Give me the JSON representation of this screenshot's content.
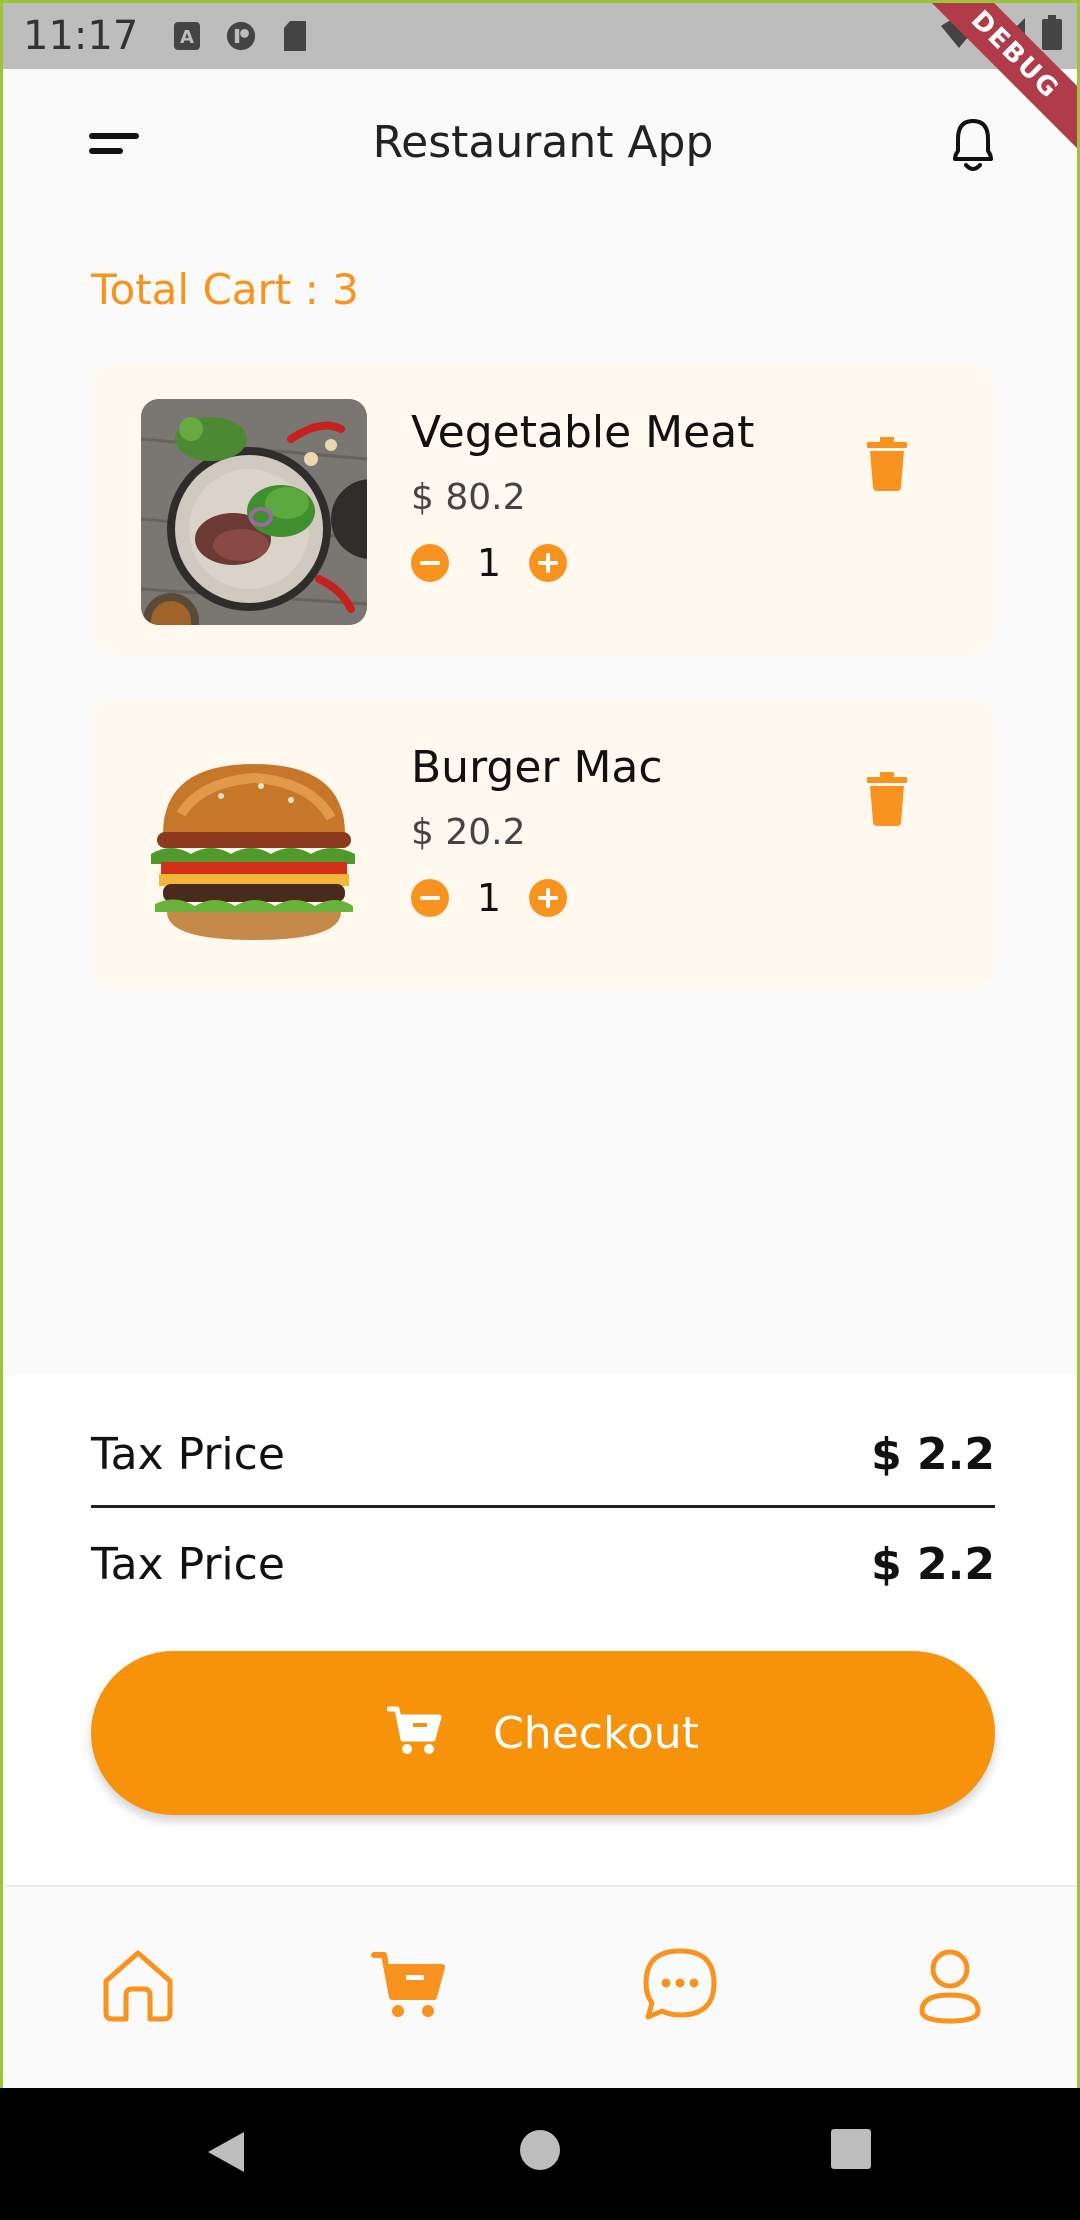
{
  "status_bar": {
    "time": "11:17",
    "debug_label": "DEBUG"
  },
  "app_bar": {
    "title": "Restaurant App"
  },
  "cart": {
    "total_label": "Total Cart : 3",
    "items": [
      {
        "name": "Vegetable Meat",
        "price": "$ 80.2",
        "quantity": "1"
      },
      {
        "name": "Burger Mac",
        "price": "$ 20.2",
        "quantity": "1"
      }
    ]
  },
  "summary": {
    "rows": [
      {
        "label": "Tax Price",
        "value": "$ 2.2"
      },
      {
        "label": "Tax Price",
        "value": "$ 2.2"
      }
    ],
    "checkout_label": "Checkout"
  },
  "bottom_nav": {
    "items": [
      "home-icon",
      "cart-icon",
      "chat-icon",
      "profile-icon"
    ]
  },
  "colors": {
    "accent": "#f7931e",
    "card_bg": "#fff8ef",
    "status_bar": "#bdbdbd"
  }
}
